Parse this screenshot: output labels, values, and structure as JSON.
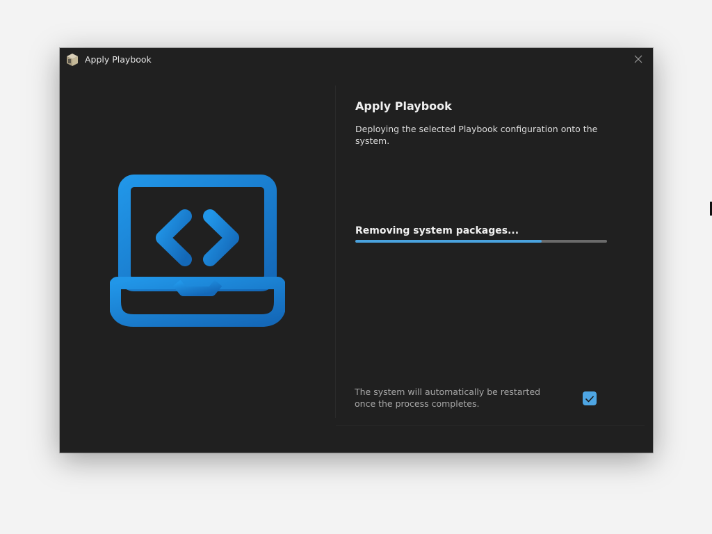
{
  "window": {
    "title": "Apply Playbook",
    "app_icon": "package-box-icon",
    "close_icon": "close-icon"
  },
  "left_pane": {
    "illustration": "laptop-code-icon",
    "accent_color": "#1e88d8"
  },
  "main": {
    "heading": "Apply Playbook",
    "description": "Deploying the selected Playbook configuration onto the system.",
    "status": "Removing system packages...",
    "progress_percent": 74,
    "progress_color": "#4aa3df"
  },
  "footer": {
    "note": "The system will automatically be restarted once the process completes.",
    "restart_checkbox_checked": true,
    "checkbox_color": "#4ea6e4"
  }
}
